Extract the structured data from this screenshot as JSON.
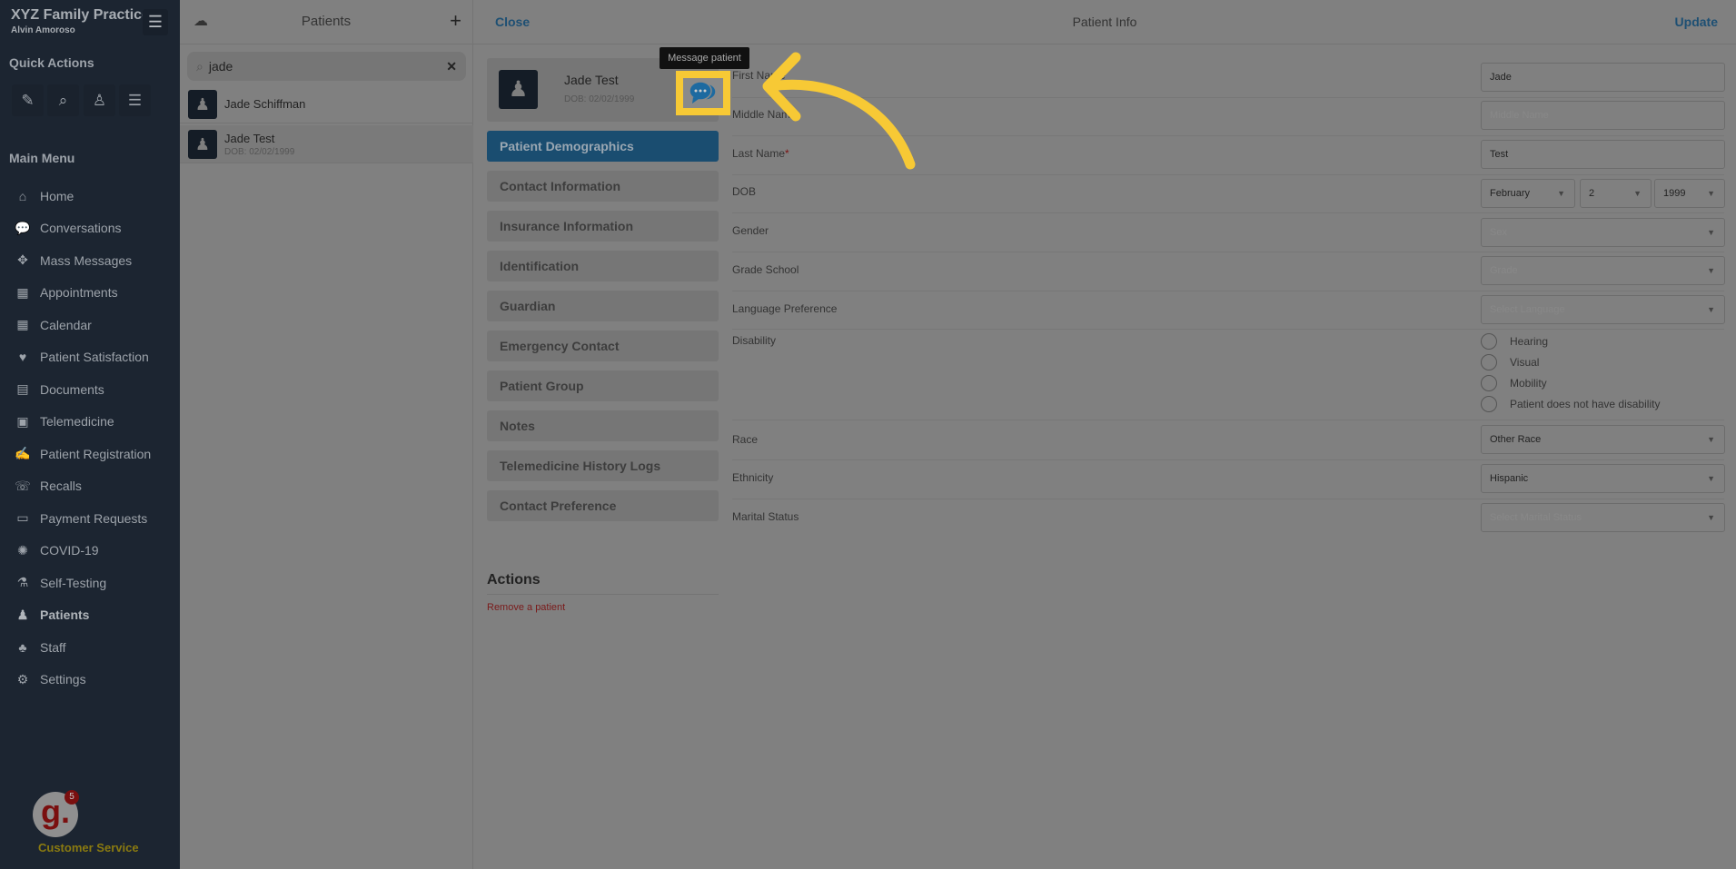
{
  "sidebar": {
    "brand": "XYZ Family Practice",
    "user": "Alvin Amoroso",
    "quick_actions_title": "Quick Actions",
    "quick_actions": [
      {
        "icon": "compose-icon",
        "glyph": "✎"
      },
      {
        "icon": "search-icon",
        "glyph": "⌕"
      },
      {
        "icon": "patient-icon",
        "glyph": "♙"
      },
      {
        "icon": "sliders-icon",
        "glyph": "☰"
      }
    ],
    "main_menu_title": "Main Menu",
    "items": [
      {
        "label": "Home",
        "icon": "home-icon",
        "glyph": "⌂"
      },
      {
        "label": "Conversations",
        "icon": "conversations-icon",
        "glyph": "💬"
      },
      {
        "label": "Mass Messages",
        "icon": "mass-messages-icon",
        "glyph": "✥"
      },
      {
        "label": "Appointments",
        "icon": "appointments-icon",
        "glyph": "▦"
      },
      {
        "label": "Calendar",
        "icon": "calendar-icon",
        "glyph": "▦"
      },
      {
        "label": "Patient Satisfaction",
        "icon": "heart-icon",
        "glyph": "♥"
      },
      {
        "label": "Documents",
        "icon": "documents-icon",
        "glyph": "▤"
      },
      {
        "label": "Telemedicine",
        "icon": "telemedicine-icon",
        "glyph": "▣"
      },
      {
        "label": "Patient Registration",
        "icon": "registration-icon",
        "glyph": "✍"
      },
      {
        "label": "Recalls",
        "icon": "recalls-icon",
        "glyph": "☏"
      },
      {
        "label": "Payment Requests",
        "icon": "credit-card-icon",
        "glyph": "▭"
      },
      {
        "label": "COVID-19",
        "icon": "virus-icon",
        "glyph": "✺"
      },
      {
        "label": "Self-Testing",
        "icon": "flask-icon",
        "glyph": "⚗"
      },
      {
        "label": "Patients",
        "icon": "patient-icon",
        "glyph": "♟",
        "active": true
      },
      {
        "label": "Staff",
        "icon": "staff-icon",
        "glyph": "♣"
      },
      {
        "label": "Settings",
        "icon": "gear-icon",
        "glyph": "⚙"
      }
    ],
    "customer_service": {
      "label": "Customer Service",
      "logo": "g.",
      "badge": "5"
    }
  },
  "patients": {
    "title": "Patients",
    "search_value": "jade",
    "rows": [
      {
        "name": "Jade Schiffman",
        "dob": ""
      },
      {
        "name": "Jade Test",
        "dob": "DOB: 02/02/1999"
      }
    ]
  },
  "main": {
    "close": "Close",
    "title": "Patient Info",
    "update": "Update",
    "card": {
      "name": "Jade Test",
      "dob": "DOB: 02/02/1999",
      "tooltip": "Message patient"
    },
    "nav": [
      "Patient Demographics",
      "Contact Information",
      "Insurance Information",
      "Identification",
      "Guardian",
      "Emergency Contact",
      "Patient Group",
      "Notes",
      "Telemedicine History Logs",
      "Contact Preference"
    ],
    "actions_title": "Actions",
    "remove": "Remove a patient",
    "form": {
      "first_name": {
        "label": "First Name",
        "value": "Jade"
      },
      "middle_name": {
        "label": "Middle Name",
        "placeholder": "Middle Name"
      },
      "last_name": {
        "label": "Last Name",
        "required": "*",
        "value": "Test"
      },
      "dob": {
        "label": "DOB",
        "month": "February",
        "day": "2",
        "year": "1999"
      },
      "gender": {
        "label": "Gender",
        "placeholder": "Sex"
      },
      "grade": {
        "label": "Grade School",
        "placeholder": "Grade"
      },
      "language": {
        "label": "Language Preference",
        "placeholder": "Select Language"
      },
      "disability": {
        "label": "Disability",
        "options": [
          "Hearing",
          "Visual",
          "Mobility",
          "Patient does not have disability"
        ]
      },
      "race": {
        "label": "Race",
        "value": "Other Race"
      },
      "ethnicity": {
        "label": "Ethnicity",
        "value": "Hispanic"
      },
      "marital": {
        "label": "Marital Status",
        "placeholder": "Select Marital Status"
      }
    }
  },
  "colors": {
    "highlight": "#f7c935",
    "accent": "#1a4d70",
    "sidebar": "#1c2531"
  }
}
